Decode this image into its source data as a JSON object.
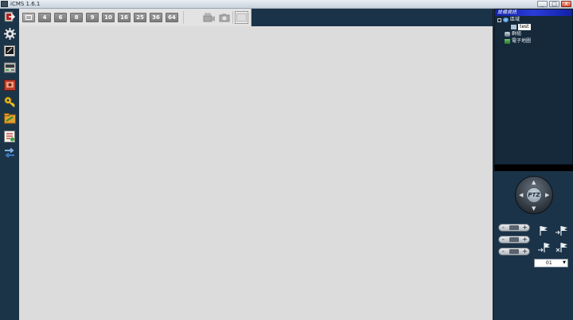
{
  "window": {
    "title": "iCMS 1.6.1",
    "buttons": [
      "_",
      "□",
      "X"
    ]
  },
  "left_toolbar": [
    {
      "name": "exit-icon"
    },
    {
      "name": "settings-gear-icon"
    },
    {
      "name": "view-monitor-icon"
    },
    {
      "name": "playback-device-icon"
    },
    {
      "name": "record-icon"
    },
    {
      "name": "key-icon"
    },
    {
      "name": "file-folder-icon"
    },
    {
      "name": "log-document-icon"
    },
    {
      "name": "switch-arrows-icon"
    }
  ],
  "view_toolbar": {
    "layouts": [
      "4",
      "6",
      "8",
      "9",
      "10",
      "16",
      "25",
      "36",
      "64"
    ]
  },
  "device_tree": {
    "header": "設備資訊",
    "items": [
      {
        "label": "區域",
        "level": 0
      },
      {
        "label": "test",
        "level": 1,
        "selected": true
      },
      {
        "label": "群組",
        "level": 0
      },
      {
        "label": "電子地圖",
        "level": 0
      }
    ]
  },
  "ptz": {
    "label": "PTZ",
    "preset_value": "01"
  },
  "colors": {
    "panel_bg": "#1b3348",
    "main_bg": "#dcdcdc",
    "tree_header": "#2a3cd8"
  }
}
